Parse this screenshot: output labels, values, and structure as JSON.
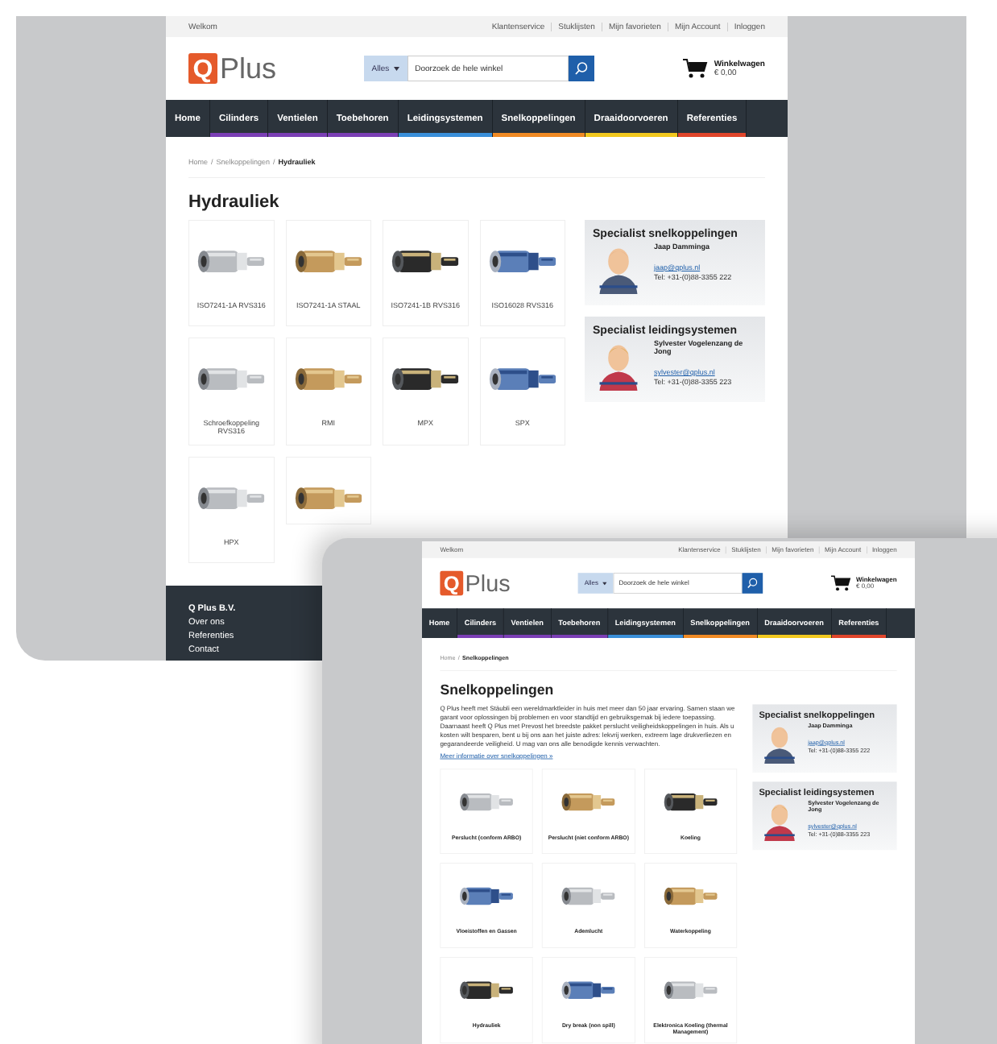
{
  "windows": [
    {
      "top_bar": {
        "greeting": "Welkom",
        "links": [
          "Klantenservice",
          "Stuklijsten",
          "Mijn favorieten",
          "Mijn Account",
          "Inloggen"
        ]
      },
      "logo": {
        "mark": "Q",
        "name": "Plus"
      },
      "search": {
        "category": "Alles",
        "placeholder": "Doorzoek de hele winkel"
      },
      "cart": {
        "label": "Winkelwagen",
        "total": "€ 0,00"
      },
      "nav": [
        {
          "label": "Home"
        },
        {
          "label": "Cilinders",
          "color": "#7b3fb5"
        },
        {
          "label": "Ventielen",
          "color": "#7b3fb5"
        },
        {
          "label": "Toebehoren",
          "color": "#7b3fb5"
        },
        {
          "label": "Leidingsystemen",
          "color": "#3a8fd9"
        },
        {
          "label": "Snelkoppelingen",
          "color": "#f08a24"
        },
        {
          "label": "Draaidoorvoeren",
          "color": "#f2c81e"
        },
        {
          "label": "Referenties",
          "color": "#e0452b"
        }
      ],
      "breadcrumb": [
        {
          "label": "Home",
          "kind": "link"
        },
        {
          "label": "/",
          "kind": "separator"
        },
        {
          "label": "Snelkoppelingen",
          "kind": "link"
        },
        {
          "label": "/",
          "kind": "separator"
        },
        {
          "label": "Hydrauliek",
          "kind": "current"
        }
      ],
      "heading": "Hydrauliek",
      "products": [
        {
          "name": "ISO7241-1A RVS316"
        },
        {
          "name": "ISO7241-1A STAAL"
        },
        {
          "name": "ISO7241-1B RVS316"
        },
        {
          "name": "ISO16028 RVS316"
        },
        {
          "name": "Schroefkoppeling RVS316"
        },
        {
          "name": "RMI"
        },
        {
          "name": "MPX"
        },
        {
          "name": "SPX"
        },
        {
          "name": "HPX"
        },
        {
          "kind": "picture"
        }
      ],
      "specialists": [
        {
          "title": "Specialist snelkoppelingen",
          "name": "Jaap Damminga",
          "email": "jaap@qplus.nl",
          "phone": "Tel: +31-(0)88-3355 222"
        },
        {
          "title": "Specialist leidingsystemen",
          "name": "Sylvester Vogelenzang de Jong",
          "email": "sylvester@qplus.nl",
          "phone": "Tel: +31-(0)88-3355 223"
        }
      ],
      "footer": {
        "company": "Q Plus B.V.",
        "links": [
          "Over ons",
          "Referenties",
          "Contact"
        ]
      }
    },
    {
      "top_bar": {
        "greeting": "Welkom",
        "links": [
          "Klantenservice",
          "Stuklijsten",
          "Mijn favorieten",
          "Mijn Account",
          "Inloggen"
        ]
      },
      "logo": {
        "mark": "Q",
        "name": "Plus"
      },
      "search": {
        "category": "Alles",
        "placeholder": "Doorzoek de hele winkel"
      },
      "cart": {
        "label": "Winkelwagen",
        "total": "€ 0,00"
      },
      "nav": [
        {
          "label": "Home"
        },
        {
          "label": "Cilinders",
          "color": "#7b3fb5"
        },
        {
          "label": "Ventielen",
          "color": "#7b3fb5"
        },
        {
          "label": "Toebehoren",
          "color": "#7b3fb5"
        },
        {
          "label": "Leidingsystemen",
          "color": "#3a8fd9"
        },
        {
          "label": "Snelkoppelingen",
          "color": "#f08a24"
        },
        {
          "label": "Draaidoorvoeren",
          "color": "#f2c81e"
        },
        {
          "label": "Referenties",
          "color": "#e0452b"
        }
      ],
      "breadcrumb": [
        {
          "label": "Home",
          "kind": "link"
        },
        {
          "label": "/",
          "kind": "separator"
        },
        {
          "label": "Snelkoppelingen",
          "kind": "current"
        }
      ],
      "heading": "Snelkoppelingen",
      "intro": "Q Plus heeft met Stäubli een wereldmarktleider in huis met meer dan 50 jaar ervaring. Samen staan we garant voor oplossingen bij problemen en voor standtijd en gebruiksgemak bij iedere toepassing. Daarnaast heeft Q Plus met Prevost het breedste pakket perslucht veiligheidskoppelingen in huis. Als u kosten wilt besparen, bent u bij ons aan het juiste adres: lekvrij werken, extreem lage drukverliezen en gegarandeerde veiligheid. U mag van ons alle benodigde kennis verwachten.",
      "more_link": "Meer informatie over snelkoppelingen »",
      "products": [
        {
          "name": "Perslucht (conform ARBO)"
        },
        {
          "name": "Perslucht (niet conform ARBO)"
        },
        {
          "name": "Koeling"
        },
        {
          "name": "Vloeistoffen en Gassen"
        },
        {
          "name": "Ademlucht"
        },
        {
          "name": "Waterkoppeling"
        },
        {
          "name": "Hydrauliek"
        },
        {
          "name": "Dry break (non spill)"
        },
        {
          "name": "Elektronica Koeling (thermal Management)"
        }
      ],
      "specialists": [
        {
          "title": "Specialist snelkoppelingen",
          "name": "Jaap Damminga",
          "email": "jaap@qplus.nl",
          "phone": "Tel: +31-(0)88-3355 222"
        },
        {
          "title": "Specialist leidingsystemen",
          "name": "Sylvester Vogelenzang de Jong",
          "email": "sylvester@qplus.nl",
          "phone": "Tel: +31-(0)88-3355 223"
        }
      ]
    }
  ]
}
